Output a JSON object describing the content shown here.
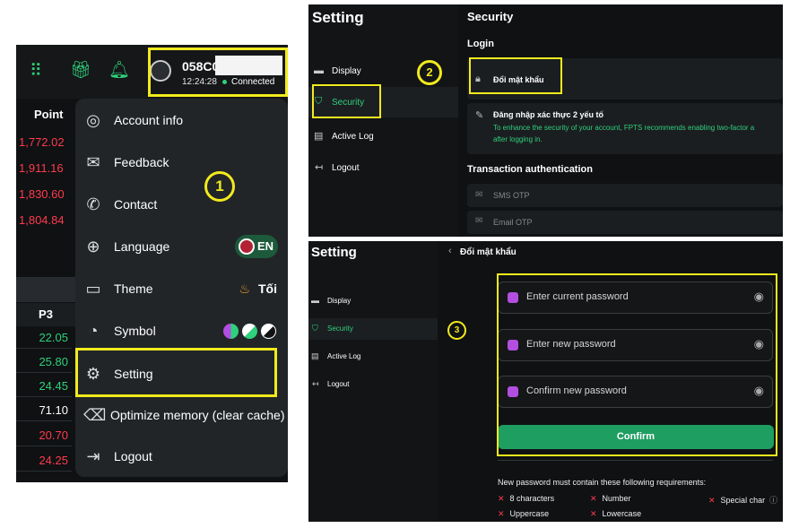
{
  "panel1": {
    "topbar": {
      "grid_icon": "apps-grid-icon",
      "gift_icon": "gift-icon",
      "bell_icon": "bell-icon",
      "account_id": "058C0",
      "time": "12:24:28",
      "status": "Connected"
    },
    "column_header": "Point",
    "prices": [
      "1,772.02",
      "1,911.16",
      "1,830.60",
      "1,804.84"
    ],
    "table_header": "P3",
    "table_rows": [
      {
        "value": "22.05",
        "color": "green"
      },
      {
        "value": "25.80",
        "color": "green"
      },
      {
        "value": "24.45",
        "color": "green"
      },
      {
        "value": "71.10",
        "color": "white"
      },
      {
        "value": "20.70",
        "color": "red"
      },
      {
        "value": "24.25",
        "color": "red"
      }
    ],
    "menu": {
      "account_info": "Account info",
      "feedback": "Feedback",
      "contact": "Contact",
      "language": "Language",
      "language_value": "EN",
      "theme": "Theme",
      "theme_value": "Tối",
      "symbol": "Symbol",
      "setting": "Setting",
      "optimize": "Optimize memory (clear cache)",
      "logout": "Logout"
    },
    "step_badge": "1"
  },
  "sidebar": {
    "title": "Setting",
    "items": [
      "Display",
      "Security",
      "Active Log",
      "Logout"
    ]
  },
  "panel2": {
    "title": "Security",
    "login_heading": "Login",
    "change_password": "Đổi mật khẩu",
    "two_factor_title": "Đăng nhập xác thực 2 yếu tố",
    "two_factor_desc_1": "To enhance the security of your account, FPTS recommends enabling two-factor a",
    "two_factor_desc_2": "after logging in.",
    "transaction_heading": "Transaction authentication",
    "sms_otp": "SMS OTP",
    "email_otp": "Email OTP",
    "step_badge": "2"
  },
  "panel3": {
    "back_title": "Đổi mật khẩu",
    "current_password_placeholder": "Enter current password",
    "new_password_placeholder": "Enter new password",
    "confirm_password_placeholder": "Confirm new password",
    "confirm_button": "Confirm",
    "requirements_title": "New password must contain these following requirements:",
    "requirements": [
      "8 characters",
      "Number",
      "Special char",
      "Uppercase",
      "Lowercase"
    ],
    "step_badge": "3"
  },
  "colors": {
    "accent_green": "#2fd07b",
    "confirm_button": "#1f9e62",
    "negative_red": "#ff3b4d",
    "highlight_yellow": "#f2ea1d",
    "background": "#0f1113"
  }
}
